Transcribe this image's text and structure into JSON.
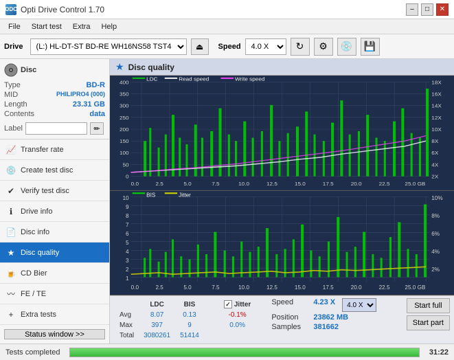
{
  "app": {
    "title": "Opti Drive Control 1.70",
    "icon": "ODC"
  },
  "title_controls": {
    "minimize": "–",
    "maximize": "□",
    "close": "✕"
  },
  "menu": {
    "items": [
      "File",
      "Start test",
      "Extra",
      "Help"
    ]
  },
  "toolbar": {
    "drive_label": "Drive",
    "drive_value": "(L:)  HL-DT-ST BD-RE  WH16NS58 TST4",
    "speed_label": "Speed",
    "speed_value": "4.0 X"
  },
  "disc": {
    "title": "Disc",
    "type_label": "Type",
    "type_value": "BD-R",
    "mid_label": "MID",
    "mid_value": "PHILIPRO4 (000)",
    "length_label": "Length",
    "length_value": "23.31 GB",
    "contents_label": "Contents",
    "contents_value": "data",
    "label_label": "Label",
    "label_value": ""
  },
  "nav": {
    "items": [
      {
        "id": "transfer-rate",
        "label": "Transfer rate",
        "icon": "📈"
      },
      {
        "id": "create-test-disc",
        "label": "Create test disc",
        "icon": "💿"
      },
      {
        "id": "verify-test-disc",
        "label": "Verify test disc",
        "icon": "✔"
      },
      {
        "id": "drive-info",
        "label": "Drive info",
        "icon": "ℹ"
      },
      {
        "id": "disc-info",
        "label": "Disc info",
        "icon": "📄"
      },
      {
        "id": "disc-quality",
        "label": "Disc quality",
        "icon": "★",
        "active": true
      },
      {
        "id": "cd-bier",
        "label": "CD Bier",
        "icon": "🍺"
      },
      {
        "id": "fe-te",
        "label": "FE / TE",
        "icon": "〰"
      },
      {
        "id": "extra-tests",
        "label": "Extra tests",
        "icon": "+"
      }
    ]
  },
  "status_window_btn": "Status window >>",
  "content": {
    "title": "Disc quality"
  },
  "chart_top": {
    "legend": [
      {
        "label": "LDC",
        "color": "#00cc00"
      },
      {
        "label": "Read speed",
        "color": "#ffffff"
      },
      {
        "label": "Write speed",
        "color": "#ff44ff"
      }
    ],
    "y_left": [
      "400",
      "350",
      "300",
      "250",
      "200",
      "150",
      "100",
      "50",
      "0"
    ],
    "y_right": [
      "18X",
      "16X",
      "14X",
      "12X",
      "10X",
      "8X",
      "6X",
      "4X",
      "2X"
    ],
    "x_labels": [
      "0.0",
      "2.5",
      "5.0",
      "7.5",
      "10.0",
      "12.5",
      "15.0",
      "17.5",
      "20.0",
      "22.5",
      "25.0 GB"
    ]
  },
  "chart_bottom": {
    "legend": [
      {
        "label": "BIS",
        "color": "#00cc00"
      },
      {
        "label": "Jitter",
        "color": "#ffff00"
      }
    ],
    "y_left": [
      "10",
      "9",
      "8",
      "7",
      "6",
      "5",
      "4",
      "3",
      "2",
      "1"
    ],
    "y_right": [
      "10%",
      "8%",
      "6%",
      "4%",
      "2%"
    ],
    "x_labels": [
      "0.0",
      "2.5",
      "5.0",
      "7.5",
      "10.0",
      "12.5",
      "15.0",
      "17.5",
      "20.0",
      "22.5",
      "25.0 GB"
    ]
  },
  "stats": {
    "headers": [
      "LDC",
      "BIS",
      "",
      "Jitter"
    ],
    "avg_label": "Avg",
    "avg_ldc": "8.07",
    "avg_bis": "0.13",
    "avg_jitter": "-0.1%",
    "max_label": "Max",
    "max_ldc": "397",
    "max_bis": "9",
    "max_jitter": "0.0%",
    "total_label": "Total",
    "total_ldc": "3080261",
    "total_bis": "51414",
    "jitter_checked": true,
    "jitter_label": "Jitter",
    "speed_label": "Speed",
    "speed_value": "4.23 X",
    "speed_select": "4.0 X",
    "position_label": "Position",
    "position_value": "23862 MB",
    "samples_label": "Samples",
    "samples_value": "381662",
    "btn_start_full": "Start full",
    "btn_start_part": "Start part"
  },
  "bottom_bar": {
    "status": "Tests completed",
    "progress": 100,
    "time": "31:22"
  }
}
